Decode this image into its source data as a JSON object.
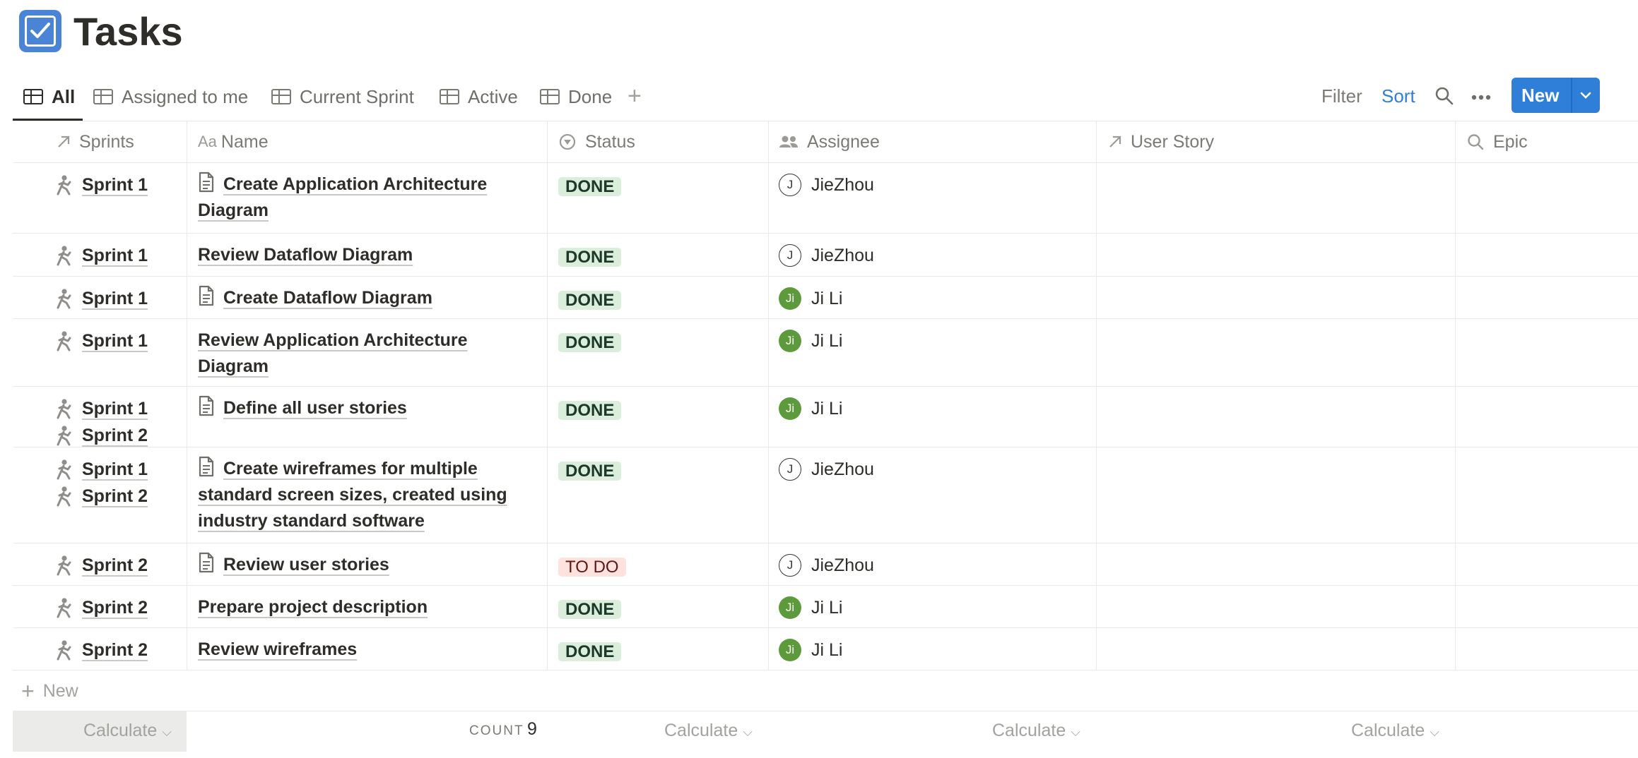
{
  "page": {
    "title": "Tasks"
  },
  "views": [
    {
      "label": "All",
      "active": true
    },
    {
      "label": "Assigned to me"
    },
    {
      "label": "Current Sprint"
    },
    {
      "label": "Active"
    },
    {
      "label": "Done"
    }
  ],
  "toolbar": {
    "filter": "Filter",
    "sort": "Sort",
    "new_label": "New"
  },
  "columns": {
    "sprints": "Sprints",
    "name": "Name",
    "status": "Status",
    "assignee": "Assignee",
    "user_story": "User Story",
    "epic": "Epic"
  },
  "rows": [
    {
      "sprints": [
        "Sprint 1"
      ],
      "name_lines": [
        "Create Application Architecture",
        "Diagram"
      ],
      "has_doc": true,
      "status": "DONE",
      "assignee": "JieZhou",
      "initial": "J"
    },
    {
      "sprints": [
        "Sprint 1"
      ],
      "name_lines": [
        "Review Dataflow Diagram"
      ],
      "has_doc": false,
      "status": "DONE",
      "assignee": "JieZhou",
      "initial": "J"
    },
    {
      "sprints": [
        "Sprint 1"
      ],
      "name_lines": [
        "Create Dataflow Diagram"
      ],
      "has_doc": true,
      "status": "DONE",
      "assignee": "Ji Li",
      "initial": "Ji"
    },
    {
      "sprints": [
        "Sprint 1"
      ],
      "name_lines": [
        "Review Application Architecture",
        "Diagram"
      ],
      "has_doc": false,
      "status": "DONE",
      "assignee": "Ji Li",
      "initial": "Ji"
    },
    {
      "sprints": [
        "Sprint 1",
        "Sprint 2"
      ],
      "name_lines": [
        "Define all user stories"
      ],
      "has_doc": true,
      "status": "DONE",
      "assignee": "Ji Li",
      "initial": "Ji"
    },
    {
      "sprints": [
        "Sprint 1",
        "Sprint 2"
      ],
      "name_lines": [
        "Create wireframes for multiple",
        "standard screen sizes, created using",
        "industry standard software"
      ],
      "has_doc": true,
      "status": "DONE",
      "assignee": "JieZhou",
      "initial": "J"
    },
    {
      "sprints": [
        "Sprint 2"
      ],
      "name_lines": [
        "Review user stories"
      ],
      "has_doc": true,
      "status": "TO DO",
      "assignee": "JieZhou",
      "initial": "J"
    },
    {
      "sprints": [
        "Sprint 2"
      ],
      "name_lines": [
        "Prepare project description"
      ],
      "has_doc": false,
      "status": "DONE",
      "assignee": "Ji Li",
      "initial": "Ji"
    },
    {
      "sprints": [
        "Sprint 2"
      ],
      "name_lines": [
        "Review wireframes"
      ],
      "has_doc": false,
      "status": "DONE",
      "assignee": "Ji Li",
      "initial": "Ji"
    }
  ],
  "footer": {
    "new_row": "New",
    "calculate": "Calculate",
    "count_label": "COUNT",
    "count_value": "9"
  }
}
